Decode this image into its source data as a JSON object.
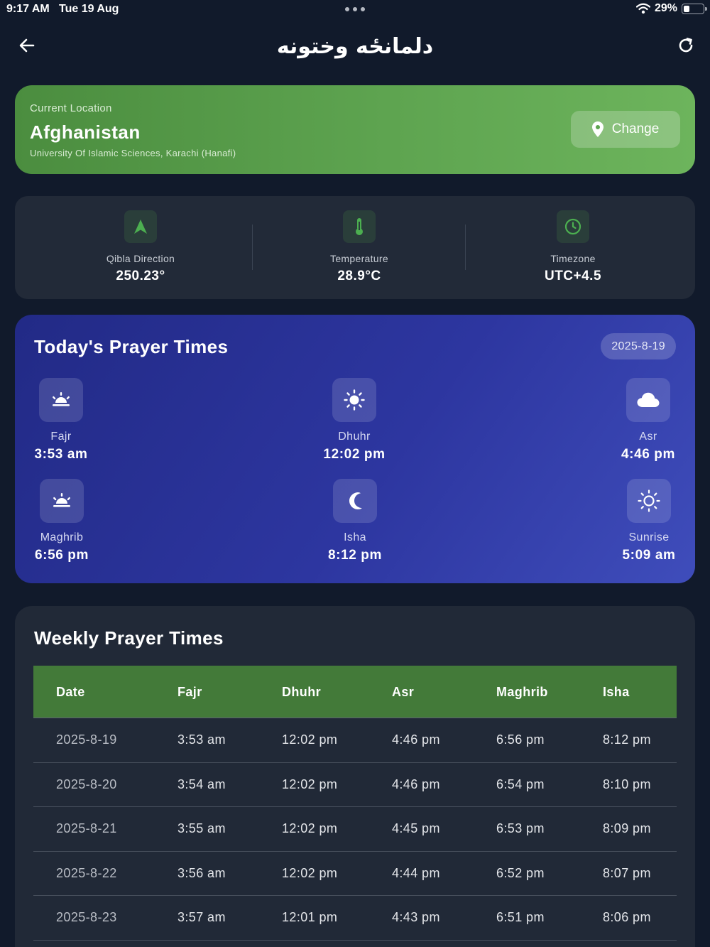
{
  "status_bar": {
    "time": "9:17 AM",
    "date": "Tue 19 Aug",
    "battery_percent": "29%",
    "battery_level": 0.29
  },
  "header": {
    "title": "دلمانځه وختونه",
    "back_icon": "arrow-left-icon",
    "refresh_icon": "refresh-icon"
  },
  "location": {
    "label": "Current Location",
    "name": "Afghanistan",
    "method": "University Of Islamic Sciences, Karachi (Hanafi)",
    "change_label": "Change"
  },
  "info": {
    "qibla": {
      "label": "Qibla Direction",
      "value": "250.23°",
      "icon": "navigation-arrow-icon"
    },
    "temperature": {
      "label": "Temperature",
      "value": "28.9°C",
      "icon": "thermometer-icon"
    },
    "timezone": {
      "label": "Timezone",
      "value": "UTC+4.5",
      "icon": "clock-icon"
    }
  },
  "today": {
    "title": "Today's Prayer Times",
    "date": "2025-8-19",
    "prayers": [
      {
        "name": "Fajr",
        "time": "3:53 am",
        "icon": "sunrise-icon"
      },
      {
        "name": "Dhuhr",
        "time": "12:02 pm",
        "icon": "sun-icon"
      },
      {
        "name": "Asr",
        "time": "4:46 pm",
        "icon": "cloud-icon"
      },
      {
        "name": "Maghrib",
        "time": "6:56 pm",
        "icon": "sunset-icon"
      },
      {
        "name": "Isha",
        "time": "8:12 pm",
        "icon": "moon-icon"
      },
      {
        "name": "Sunrise",
        "time": "5:09 am",
        "icon": "sun-outline-icon"
      }
    ]
  },
  "weekly": {
    "title": "Weekly Prayer Times",
    "columns": [
      "Date",
      "Fajr",
      "Dhuhr",
      "Asr",
      "Maghrib",
      "Isha"
    ],
    "rows": [
      [
        "2025-8-19",
        "3:53 am",
        "12:02 pm",
        "4:46 pm",
        "6:56 pm",
        "8:12 pm"
      ],
      [
        "2025-8-20",
        "3:54 am",
        "12:02 pm",
        "4:46 pm",
        "6:54 pm",
        "8:10 pm"
      ],
      [
        "2025-8-21",
        "3:55 am",
        "12:02 pm",
        "4:45 pm",
        "6:53 pm",
        "8:09 pm"
      ],
      [
        "2025-8-22",
        "3:56 am",
        "12:02 pm",
        "4:44 pm",
        "6:52 pm",
        "8:07 pm"
      ],
      [
        "2025-8-23",
        "3:57 am",
        "12:01 pm",
        "4:43 pm",
        "6:51 pm",
        "8:06 pm"
      ]
    ]
  },
  "colors": {
    "background": "#111a2b",
    "location_card": "#5ea450",
    "info_icon_accent": "#4caf50",
    "prayer_card": "#2d36a0",
    "table_header": "#437a39"
  }
}
